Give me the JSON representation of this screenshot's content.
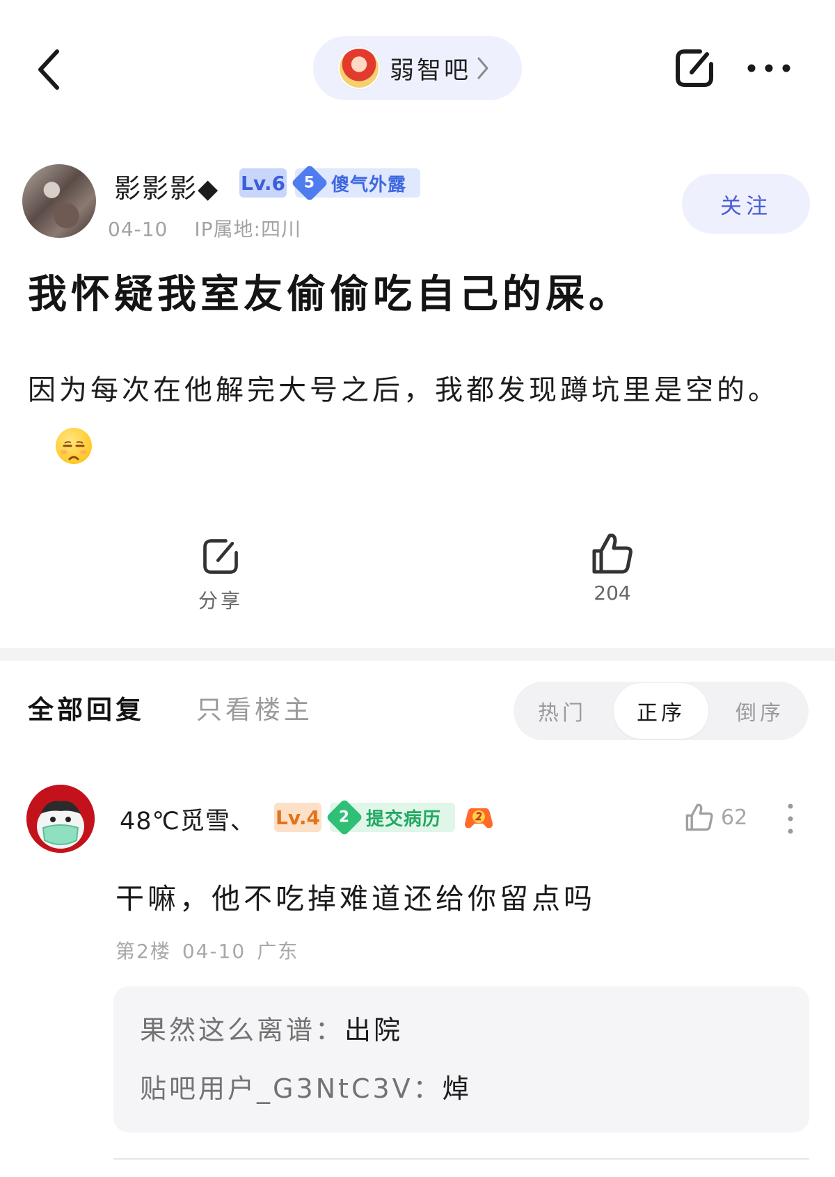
{
  "header": {
    "forum_name": "弱智吧"
  },
  "post": {
    "author": {
      "name": "影影影◆",
      "level": "Lv.6",
      "badge_number": "5",
      "badge_title": "傻气外露",
      "date": "04-10",
      "ip": "IP属地:四川"
    },
    "follow_label": "关注",
    "title": "我怀疑我室友偷偷吃自己的屎。",
    "body": "因为每次在他解完大号之后，我都发现蹲坑里是空的。",
    "share_label": "分享",
    "like_count": "204"
  },
  "tabs": {
    "all": "全部回复",
    "op_only": "只看楼主",
    "sort": [
      "热门",
      "正序",
      "倒序"
    ],
    "sort_active": "正序"
  },
  "comment": {
    "author": "48℃觅雪、",
    "level": "Lv.4",
    "badge_number": "2",
    "badge_title": "提交病历",
    "like_count": "62",
    "text": "干嘛，他不吃掉难道还给你留点吗",
    "floor": "第2楼",
    "date": "04-10",
    "location": "广东",
    "replies": [
      {
        "user": "果然这么离谱：",
        "text": "出院"
      },
      {
        "user": "贴吧用户_G3NtC3V：",
        "text": "焯"
      }
    ]
  },
  "colors": {
    "accent": "#4b5cd6",
    "pill_bg": "#eef0fd",
    "level_blue": "#3b5fd9",
    "level_orange": "#e0741d",
    "badge_green": "#22a862"
  }
}
